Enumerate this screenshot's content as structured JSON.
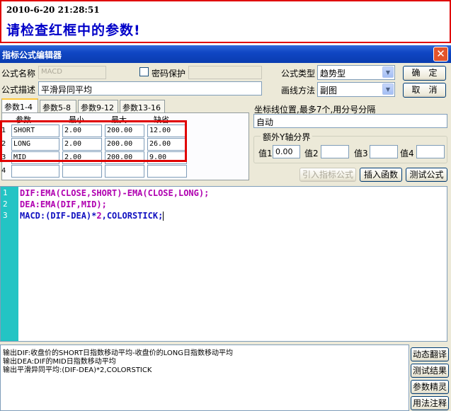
{
  "notice": {
    "timestamp": "2010-6-20 21:28:51",
    "message": "请检查红框中的参数!"
  },
  "window": {
    "title": "指标公式编辑器",
    "close_icon": "close-icon"
  },
  "form": {
    "name_label": "公式名称",
    "name_value": "MACD",
    "password_label": "密码保护",
    "password_checked": false,
    "password_value": "",
    "desc_label": "公式描述",
    "desc_value": "平滑异同平均",
    "type_label": "公式类型",
    "type_value": "趋势型",
    "draw_label": "画线方法",
    "draw_value": "副图",
    "ok_label": "确　定",
    "cancel_label": "取　消"
  },
  "params": {
    "tabs": [
      "参数1-4",
      "参数5-8",
      "参数9-12",
      "参数13-16"
    ],
    "active_tab": 0,
    "headers": [
      "参数",
      "最小",
      "最大",
      "缺省"
    ],
    "rows": [
      {
        "num": "1",
        "name": "SHORT",
        "min": "2.00",
        "max": "200.00",
        "def": "12.00"
      },
      {
        "num": "2",
        "name": "LONG",
        "min": "2.00",
        "max": "200.00",
        "def": "26.00"
      },
      {
        "num": "3",
        "name": "MID",
        "min": "2.00",
        "max": "200.00",
        "def": "9.00"
      },
      {
        "num": "4",
        "name": "",
        "min": "",
        "max": "",
        "def": ""
      }
    ]
  },
  "coords": {
    "label": "坐标线位置,最多7个,用分号分隔",
    "value": "自动",
    "group_title": "额外Y轴分界",
    "vals": [
      {
        "label": "值1",
        "value": "0.00"
      },
      {
        "label": "值2",
        "value": ""
      },
      {
        "label": "值3",
        "value": ""
      },
      {
        "label": "值4",
        "value": ""
      }
    ]
  },
  "actions": {
    "import_label": "引入指标公式",
    "insert_label": "插入函数",
    "test_label": "测试公式"
  },
  "editor": {
    "line_numbers": [
      "1",
      "2",
      "3"
    ],
    "line1": "DIF:EMA(CLOSE,SHORT)-EMA(CLOSE,LONG);",
    "line2": "DEA:EMA(DIF,MID);",
    "line3_a": "MACD:(DIF-DEA)*",
    "line3_b": "2",
    "line3_c": ",COLORSTICK;"
  },
  "output": {
    "lines": [
      "输出DIF:收盘价的SHORT日指数移动平均-收盘价的LONG日指数移动平均",
      "输出DEA:DIF的MID日指数移动平均",
      "输出平滑异同平均:(DIF-DEA)*2,COLORSTICK"
    ]
  },
  "side_buttons": [
    "动态翻译",
    "测试结果",
    "参数精灵",
    "用法注释"
  ]
}
